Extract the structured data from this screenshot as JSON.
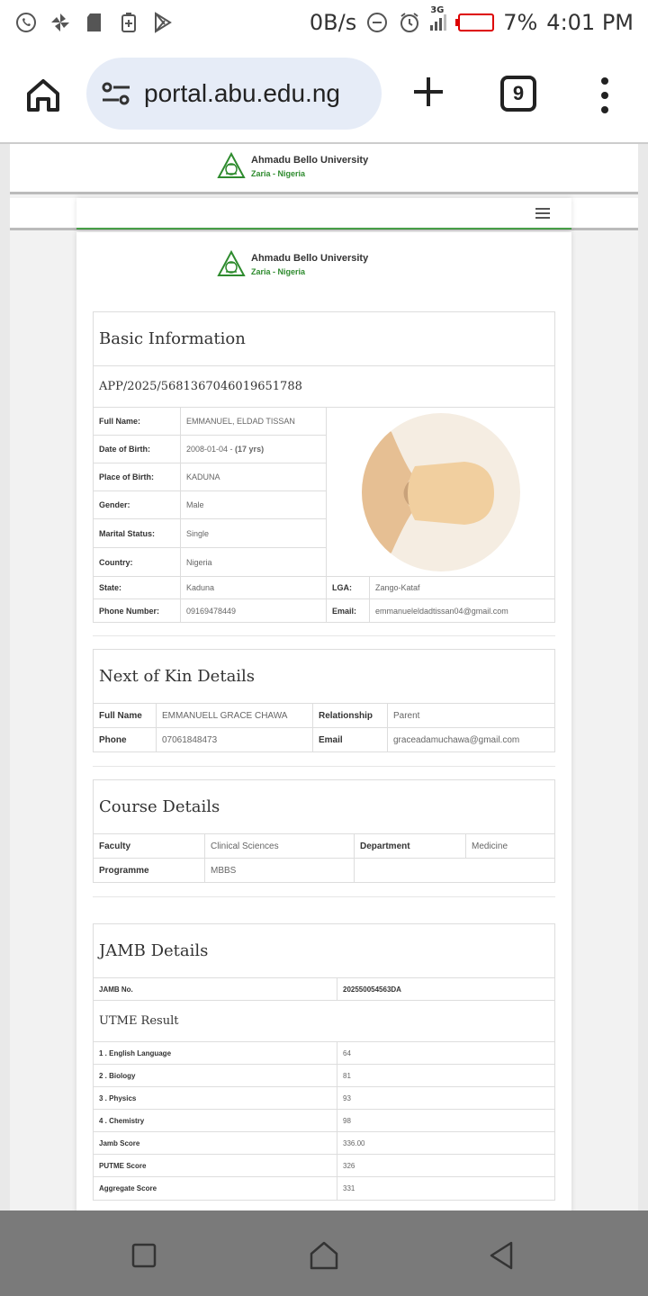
{
  "status_bar": {
    "net_speed": "0B/s",
    "network": "3G",
    "battery": "7%",
    "time": "4:01 PM"
  },
  "browser": {
    "url": "portal.abu.edu.ng",
    "tab_count": "9"
  },
  "brand": {
    "name": "Ahmadu Bello University",
    "sub": "Zaria - Nigeria"
  },
  "basic": {
    "title": "Basic Information",
    "app_no": "APP/2025/5681367046019651788",
    "rows": [
      {
        "label": "Full Name:",
        "value": "EMMANUEL, ELDAD TISSAN"
      },
      {
        "label": "Date of Birth:",
        "value": "2008-01-04 - ",
        "extra": "(17 yrs)"
      },
      {
        "label": "Place of Birth:",
        "value": "KADUNA"
      },
      {
        "label": "Gender:",
        "value": "Male"
      },
      {
        "label": "Marital Status:",
        "value": "Single"
      },
      {
        "label": "Country:",
        "value": "Nigeria"
      }
    ],
    "state_label": "State:",
    "state": "Kaduna",
    "lga_label": "LGA:",
    "lga": "Zango-Kataf",
    "phone_label": "Phone Number:",
    "phone": "09169478449",
    "email_label": "Email:",
    "email": "emmanueleldadtissan04@gmail.com"
  },
  "kin": {
    "title": "Next of Kin Details",
    "name_label": "Full Name",
    "name": "EMMANUELL GRACE CHAWA",
    "rel_label": "Relationship",
    "rel": "Parent",
    "phone_label": "Phone",
    "phone": "07061848473",
    "email_label": "Email",
    "email": "graceadamuchawa@gmail.com"
  },
  "course": {
    "title": "Course Details",
    "faculty_label": "Faculty",
    "faculty": "Clinical Sciences",
    "dept_label": "Department",
    "dept": "Medicine",
    "prog_label": "Programme",
    "prog": "MBBS"
  },
  "jamb": {
    "title": "JAMB Details",
    "no_label": "JAMB No.",
    "no": "202550054563DA",
    "utme_title": "UTME Result",
    "rows": [
      {
        "label": "1 . English Language",
        "value": "64"
      },
      {
        "label": "2 . Biology",
        "value": "81"
      },
      {
        "label": "3 . Physics",
        "value": "93"
      },
      {
        "label": "4 . Chemistry",
        "value": "98"
      },
      {
        "label": "Jamb Score",
        "value": "336.00"
      },
      {
        "label": "PUTME Score",
        "value": "326"
      },
      {
        "label": "Aggregate Score",
        "value": "331"
      }
    ]
  },
  "colors": {
    "accent_green": "#2e8b2e",
    "url_pill": "#e6ecf7",
    "nav_bar": "#7a7a7a"
  }
}
